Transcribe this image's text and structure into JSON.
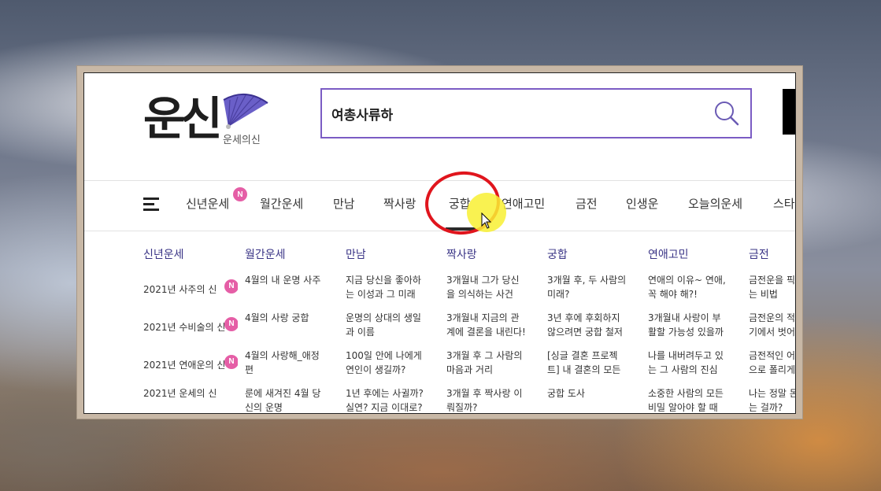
{
  "logo": {
    "text": "운신",
    "subtitle": "운세의신"
  },
  "search": {
    "value": "여총사류하",
    "icon": "search-icon"
  },
  "nav": {
    "items": [
      {
        "label": "신년운세",
        "badge": "N"
      },
      {
        "label": "월간운세"
      },
      {
        "label": "만남"
      },
      {
        "label": "짝사랑"
      },
      {
        "label": "궁합",
        "active": true
      },
      {
        "label": "연애고민"
      },
      {
        "label": "금전"
      },
      {
        "label": "인생운"
      },
      {
        "label": "오늘의운세"
      },
      {
        "label": "스타"
      }
    ]
  },
  "menu": {
    "columns": [
      {
        "title": "신년운세",
        "items": [
          {
            "lines": [
              "2021년 사주의 신"
            ],
            "badge": "N"
          },
          {
            "lines": [
              "2021년 수비술의 신"
            ],
            "badge": "N"
          },
          {
            "lines": [
              "2021년 연애운의 신"
            ],
            "badge": "N"
          },
          {
            "lines": [
              "2021년 운세의 신"
            ]
          }
        ]
      },
      {
        "title": "월간운세",
        "items": [
          {
            "lines": [
              "4월의 내 운명 사주"
            ]
          },
          {
            "lines": [
              "4월의 사랑 궁합"
            ]
          },
          {
            "lines": [
              "4월의 사랑해_애정",
              "편"
            ]
          },
          {
            "lines": [
              "룬에 새겨진 4월 당",
              "신의 운명"
            ]
          }
        ]
      },
      {
        "title": "만남",
        "items": [
          {
            "lines": [
              "지금 당신을 좋아하",
              "는 이성과 그 미래"
            ]
          },
          {
            "lines": [
              "운명의 상대의 생일",
              "과 이름"
            ]
          },
          {
            "lines": [
              "100일 안에 나에게",
              "연인이 생길까?"
            ]
          },
          {
            "lines": [
              "1년 후에는 사귈까?",
              "실연? 지금 이대로?"
            ]
          }
        ]
      },
      {
        "title": "짝사랑",
        "items": [
          {
            "lines": [
              "3개월내 그가 당신",
              "을 의식하는 사건"
            ]
          },
          {
            "lines": [
              "3개월내 지금의 관",
              "계에 결론을 내린다!"
            ]
          },
          {
            "lines": [
              "3개월 후 그 사람의",
              "마음과 거리"
            ]
          },
          {
            "lines": [
              "3개월 후 짝사랑 이",
              "뤄질까?"
            ]
          }
        ]
      },
      {
        "title": "궁합",
        "items": [
          {
            "lines": [
              "3개월 후, 두 사람의",
              "미래?"
            ]
          },
          {
            "lines": [
              "3년 후에 후회하지",
              "않으려면 궁합 철저"
            ]
          },
          {
            "lines": [
              "[싱글 결혼 프로젝",
              "트] 내 결혼의 모든"
            ]
          },
          {
            "lines": [
              "궁합 도사"
            ]
          }
        ]
      },
      {
        "title": "연애고민",
        "items": [
          {
            "lines": [
              "연애의 이유~ 연애,",
              "꼭 해야 해?!"
            ]
          },
          {
            "lines": [
              "3개월내 사랑이 부",
              "활할 가능성 있을까"
            ]
          },
          {
            "lines": [
              "나를 내버려두고 있",
              "는 그 사람의 진심"
            ]
          },
          {
            "lines": [
              "소중한 사람의 모든",
              "비밀 알아야 할 때"
            ]
          }
        ]
      },
      {
        "title": "금전",
        "items": [
          {
            "lines": [
              "금전운을 픽",
              "는 비법"
            ]
          },
          {
            "lines": [
              "금전운의 적",
              "기에서 벗어"
            ]
          },
          {
            "lines": [
              "금전적인 어",
              "으로 폴리게"
            ]
          },
          {
            "lines": [
              "나는 정말 돈",
              "는 걸까?"
            ]
          }
        ]
      }
    ]
  },
  "colors": {
    "accent": "#7b5cc4",
    "menu_heading": "#3a3486",
    "badge": "#e55ea6",
    "annotation": "#e0151d"
  }
}
